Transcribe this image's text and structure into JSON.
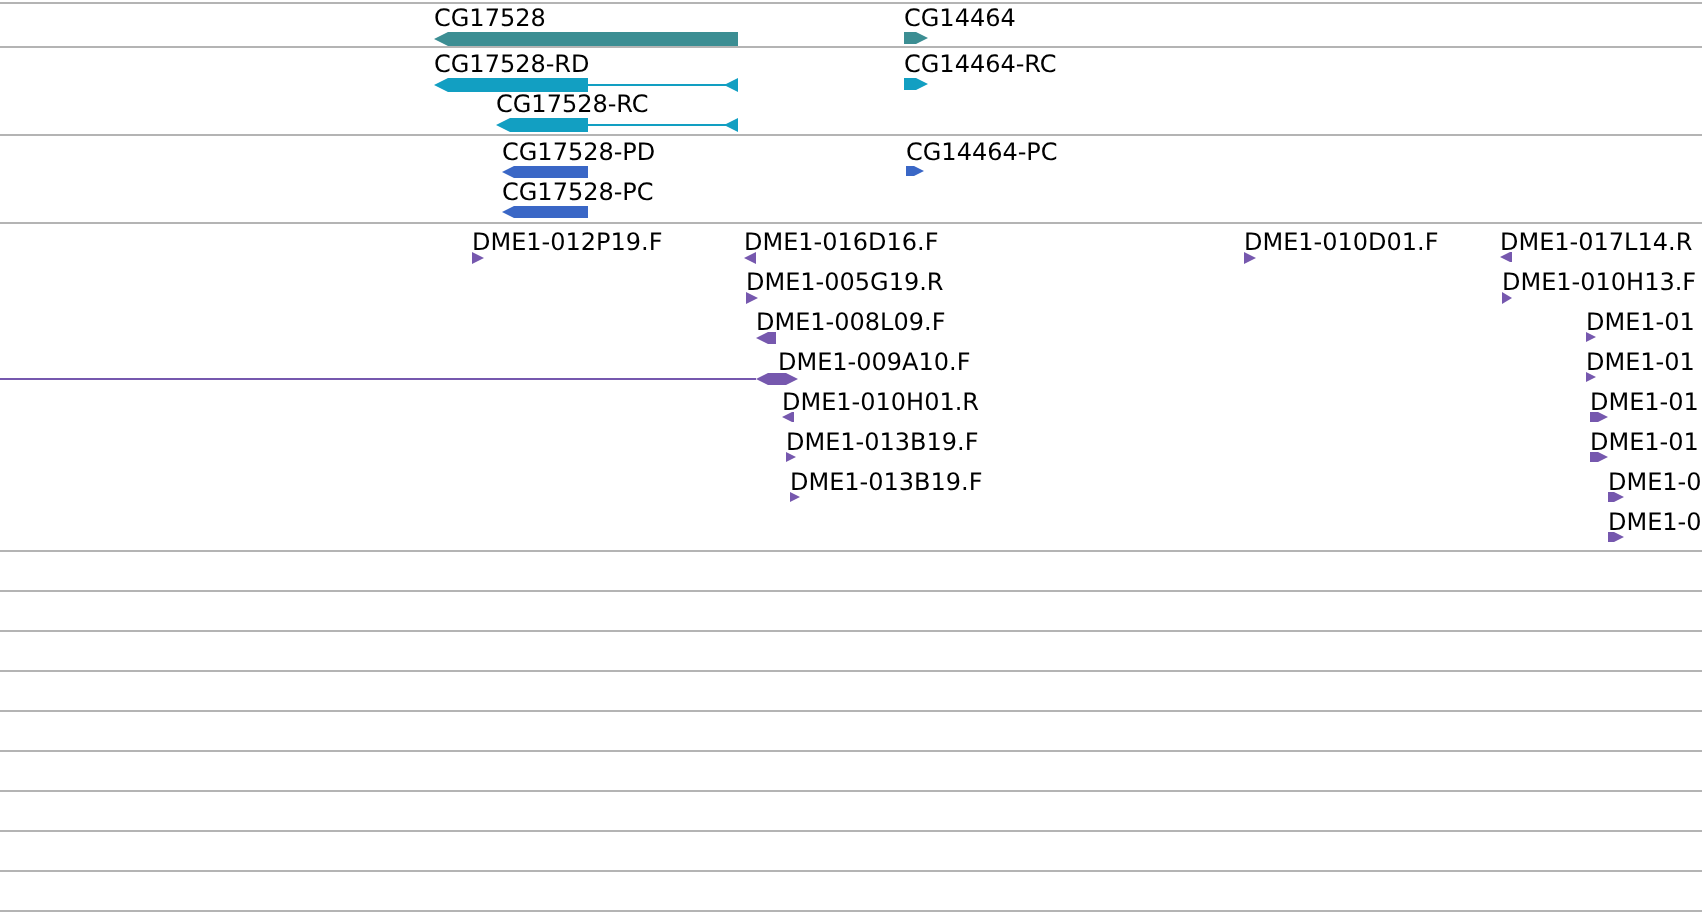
{
  "tracks": [
    {
      "kind": "gene",
      "features": [
        {
          "label": "CG17528",
          "reverse": true
        },
        {
          "label": "CG14464",
          "reverse": false
        }
      ]
    },
    {
      "kind": "transcript",
      "features": [
        {
          "label": "CG17528-RD",
          "reverse": true
        },
        {
          "label": "CG17528-RC",
          "reverse": true
        },
        {
          "label": "CG14464-RC",
          "reverse": false
        }
      ]
    },
    {
      "kind": "protein",
      "features": [
        {
          "label": "CG17528-PD",
          "reverse": true
        },
        {
          "label": "CG17528-PC",
          "reverse": true
        },
        {
          "label": "CG14464-PC",
          "reverse": false
        }
      ]
    },
    {
      "kind": "clone",
      "features": [
        {
          "label": "DME1-012P19.F",
          "reverse": false
        },
        {
          "label": "DME1-016D16.F",
          "reverse": true
        },
        {
          "label": "DME1-005G19.R",
          "reverse": false
        },
        {
          "label": "DME1-008L09.F",
          "reverse": true
        },
        {
          "label": "DME1-009A10.F",
          "reverse": false
        },
        {
          "label": "DME1-010H01.R",
          "reverse": true
        },
        {
          "label": "DME1-013B19.F",
          "reverse": false
        },
        {
          "label": "DME1-013B19.F",
          "reverse": false
        },
        {
          "label": "DME1-010D01.F",
          "reverse": false
        },
        {
          "label": "DME1-017L14.R",
          "reverse": true
        },
        {
          "label": "DME1-010H13.F",
          "reverse": false
        },
        {
          "label": "DME1-01",
          "reverse": false
        },
        {
          "label": "DME1-01",
          "reverse": false
        },
        {
          "label": "DME1-01",
          "reverse": false
        },
        {
          "label": "DME1-01",
          "reverse": false
        },
        {
          "label": "DME1-0",
          "reverse": false
        },
        {
          "label": "DME1-0",
          "reverse": false
        }
      ]
    }
  ]
}
